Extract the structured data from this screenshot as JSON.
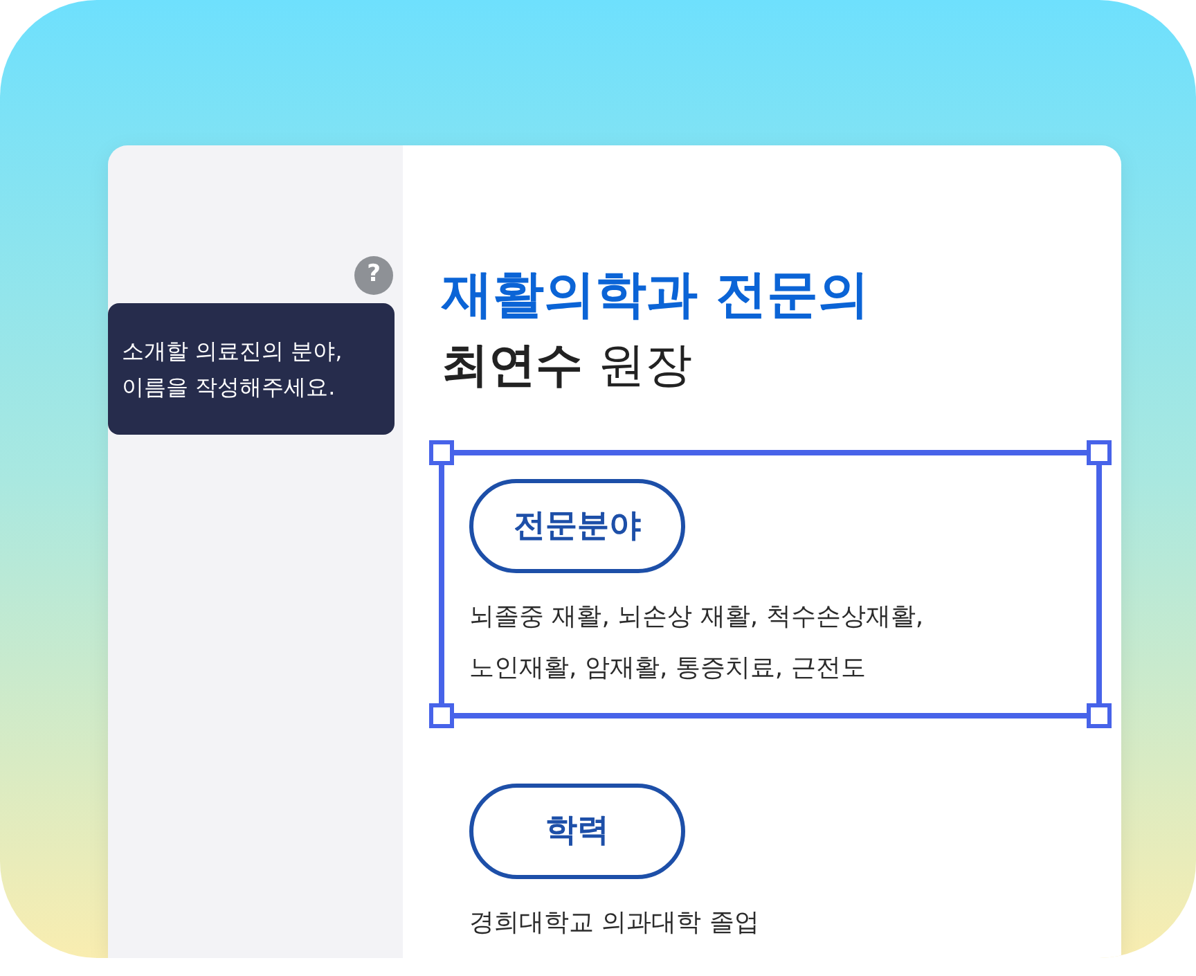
{
  "sidebar": {
    "help": "?",
    "tooltip": "소개할 의료진의 분야,\n이름을 작성해주세요."
  },
  "profile": {
    "department": "재활의학과 전문의",
    "name": "**최연수** 원장"
  },
  "sections": [
    {
      "label": "전문분야",
      "text": "뇌졸중 재활, 뇌손상 재활, 척수손상재활,\n노인재활, 암재활, 통증치료, 근전도",
      "selected": true
    },
    {
      "label": "학력",
      "text": "경희대학교 의과대학 졸업",
      "selected": false
    }
  ]
}
